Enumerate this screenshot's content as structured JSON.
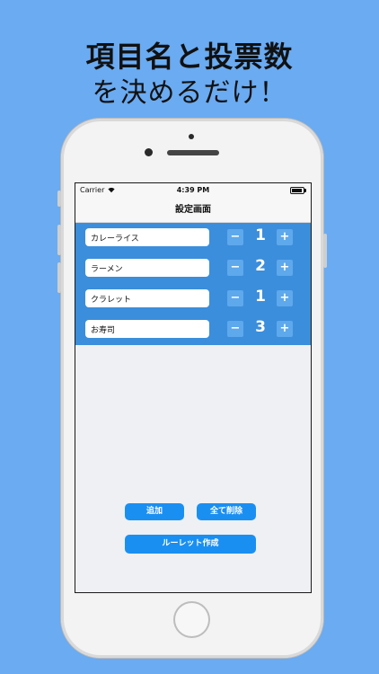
{
  "headline": {
    "line1": "項目名と投票数",
    "line2": "を決めるだけ！"
  },
  "status_bar": {
    "carrier": "Carrier",
    "time": "4:39 PM"
  },
  "nav": {
    "title": "設定画面"
  },
  "items": [
    {
      "name": "カレーライス",
      "votes": "1"
    },
    {
      "name": "ラーメン",
      "votes": "2"
    },
    {
      "name": "クラレット",
      "votes": "1"
    },
    {
      "name": "お寿司",
      "votes": "3"
    }
  ],
  "stepper": {
    "minus": "−",
    "plus": "+"
  },
  "actions": {
    "add": "追加",
    "clear_all": "全て削除",
    "create_roulette": "ルーレット作成"
  },
  "colors": {
    "background": "#6aabf2",
    "list_bg": "#3b8edb",
    "stepper_btn": "#5ea8ec",
    "action_btn": "#1a8ff2"
  }
}
